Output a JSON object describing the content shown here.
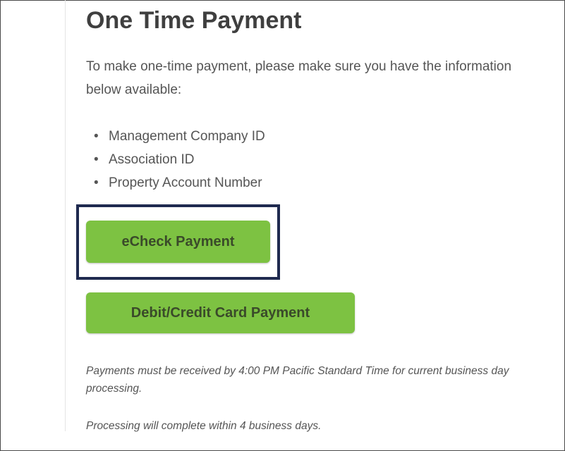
{
  "page": {
    "title": "One Time Payment",
    "intro": "To make one-time payment, please make sure you have the information below available:",
    "requirements": [
      "Management Company ID",
      "Association ID",
      "Property Account Number"
    ],
    "buttons": {
      "echeck_label": "eCheck Payment",
      "card_label": "Debit/Credit Card Payment"
    },
    "notes": {
      "deadline": "Payments must be received by 4:00 PM Pacific Standard Time for current business day processing.",
      "processing": "Processing will complete within 4 business days."
    }
  },
  "colors": {
    "button_green": "#7dc242",
    "highlight_border": "#1f2a4f",
    "title_text": "#3f3f3f",
    "body_text": "#555555"
  }
}
